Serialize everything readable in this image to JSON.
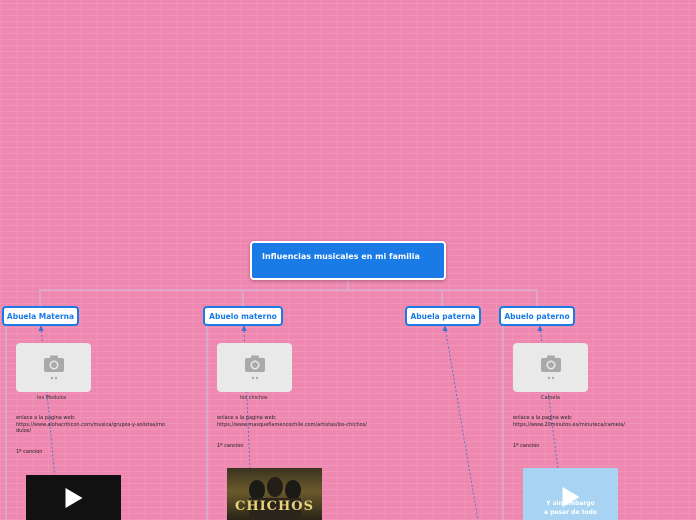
{
  "root": {
    "title": "Influencias musicales en mi familia"
  },
  "branches": [
    {
      "label": "Abuela Materna",
      "image_caption": "los Modulos",
      "link_label": "enlace a la pagina web:",
      "link_url": "https://www.alohacriticon.com/musica/grupos-y-solistas/modulos/",
      "song": "1º cancion"
    },
    {
      "label": "Abuelo materno",
      "image_caption": "los chichos",
      "link_label": "enlace a la pagina web:",
      "link_url": "https://www.masqueflamencochile.com/artistas/los-chichos/",
      "song": "1º cancion"
    },
    {
      "label": "Abuela paterna"
    },
    {
      "label": "Abuelo paterno",
      "image_caption": "Camela",
      "link_label": "enlace a la pagina web:",
      "link_url": "https://www.20minutos.es/minuteca/camela/",
      "song": "1º cancion"
    }
  ],
  "media": {
    "album_title": "CHICHOS",
    "video_caption_line1": "Y sin embargo",
    "video_caption_line2": "a pesar de todo"
  },
  "colors": {
    "background": "#ee88b0",
    "accent": "#1a7ae6",
    "connector": "#c8a8c8"
  },
  "icons": {
    "image_placeholder": "camera-icon",
    "video": "play-icon"
  }
}
